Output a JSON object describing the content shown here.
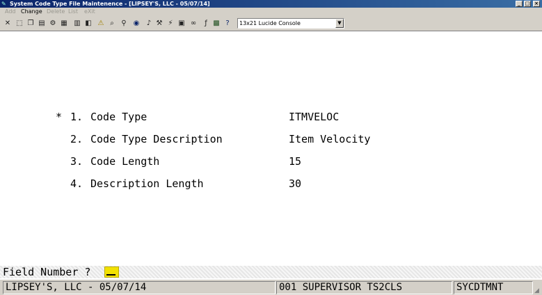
{
  "window": {
    "title": "System Code Type File Maintenence - [LIPSEY'S, LLC - 05/07/14]",
    "minimize": "_",
    "maximize": "□",
    "close": "×"
  },
  "menu": {
    "add": "Add",
    "change": "Change",
    "delete": "Delete",
    "list": "List",
    "exit": "eXit"
  },
  "toolbar": {
    "icons": [
      "close-icon",
      "select-icon",
      "copy-icon",
      "paste-icon",
      "settings-icon",
      "print-icon",
      "document-icon",
      "capture-icon",
      "alert-icon",
      "find-icon",
      "zoom-icon",
      "run-icon",
      "macro-icon",
      "tools-icon",
      "record-icon",
      "play-icon",
      "link-icon",
      "script-icon",
      "keyboard-icon",
      "help-icon"
    ],
    "font_select": "13x21 Lucide Console"
  },
  "form": {
    "marker": "*",
    "fields": [
      {
        "number": "1.",
        "label": "Code Type",
        "value": "ITMVELOC"
      },
      {
        "number": "2.",
        "label": "Code Type Description",
        "value": "Item Velocity"
      },
      {
        "number": "3.",
        "label": "Code Length",
        "value": "15"
      },
      {
        "number": "4.",
        "label": "Description Length",
        "value": "30"
      }
    ]
  },
  "prompt": {
    "label": "Field Number ?"
  },
  "status": {
    "company": "LIPSEY'S, LLC - 05/07/14",
    "session": "001 SUPERVISOR TS2CLS",
    "program": "SYCDTMNT"
  }
}
